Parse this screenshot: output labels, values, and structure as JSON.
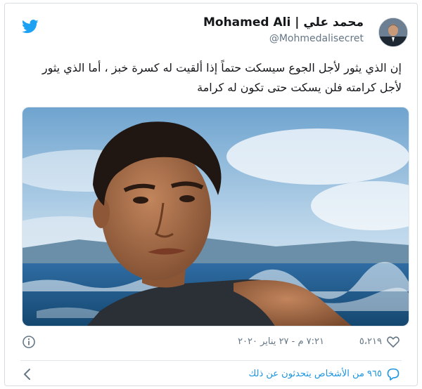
{
  "tweet": {
    "display_name": "Mohamed Ali | محمد علي",
    "handle": "@Mohmedalisecret",
    "text": "إن الذي يثور لأجل الجوع سيسكت حتماً إذا ألقيت له كسرة خبز ، أما الذي يثور لأجل كرامته فلن يسكت حتى تكون له كرامة",
    "timestamp": "٧:٢١ م - ٢٧ يناير ٢٠٢٠",
    "likes": "٥،٢١٩",
    "footer_text": "٩٦٥ من الأشخاص يتحدثون عن ذلك"
  },
  "icons": {
    "brand": "twitter-bird-icon",
    "info": "info-icon",
    "like": "heart-icon",
    "reply": "reply-bubble-icon",
    "back": "chevron-left-icon"
  },
  "colors": {
    "twitter_blue": "#1da1f2",
    "link_blue": "#1b95e0",
    "muted_gray": "#657786",
    "text": "#14171a",
    "border": "#e1e8ed"
  }
}
